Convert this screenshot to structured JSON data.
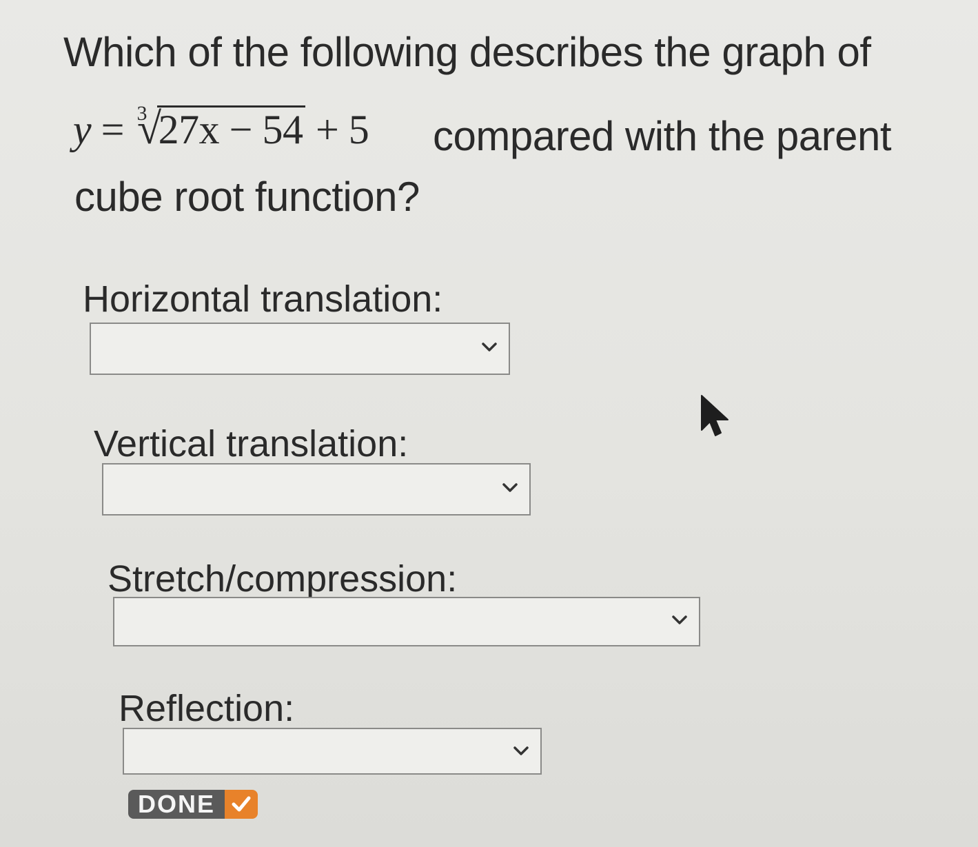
{
  "question": {
    "line1": "Which of the following describes the graph of",
    "equation": {
      "lhs": "y",
      "equals": "=",
      "root_index": "3",
      "radicand": "27x − 54",
      "tail": "+ 5"
    },
    "line2_rest": "compared with the parent",
    "line3": "cube root function?"
  },
  "fields": [
    {
      "label": "Horizontal translation:",
      "selected": ""
    },
    {
      "label": "Vertical translation:",
      "selected": ""
    },
    {
      "label": "Stretch/compression:",
      "selected": ""
    },
    {
      "label": "Reflection:",
      "selected": ""
    }
  ],
  "done_button": {
    "label": "DONE",
    "accent_color": "#e8822a"
  },
  "icons": {
    "dropdown": "chevron-down-icon",
    "done": "check-icon",
    "pointer": "mouse-cursor-icon"
  }
}
